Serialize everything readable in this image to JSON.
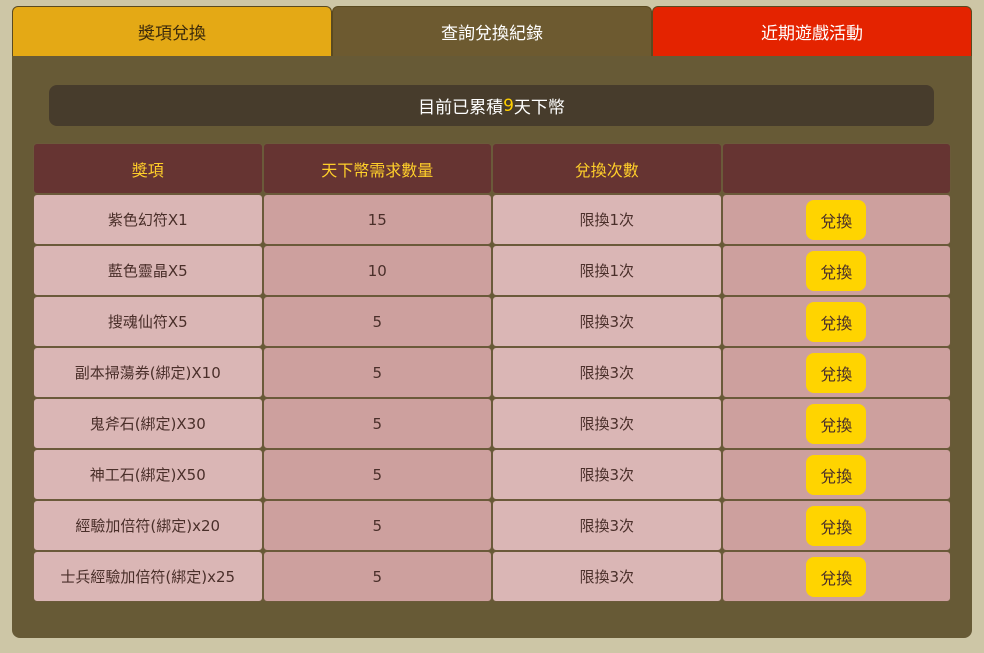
{
  "tabs": [
    {
      "label": "獎項兌換"
    },
    {
      "label": "查詢兌換紀錄"
    },
    {
      "label": "近期遊戲活動"
    }
  ],
  "banner": {
    "prefix": "目前已累積",
    "count": "9",
    "suffix": "天下幣"
  },
  "table": {
    "headers": [
      "獎項",
      "天下幣需求數量",
      "兌換次數",
      ""
    ],
    "button_label": "兌換",
    "rows": [
      {
        "item": "紫色幻符X1",
        "cost": "15",
        "limit": "限換1次"
      },
      {
        "item": "藍色靈晶X5",
        "cost": "10",
        "limit": "限換1次"
      },
      {
        "item": "搜魂仙符X5",
        "cost": "5",
        "limit": "限換3次"
      },
      {
        "item": "副本掃蕩券(綁定)X10",
        "cost": "5",
        "limit": "限換3次"
      },
      {
        "item": "鬼斧石(綁定)X30",
        "cost": "5",
        "limit": "限換3次"
      },
      {
        "item": "神工石(綁定)X50",
        "cost": "5",
        "limit": "限換3次"
      },
      {
        "item": "經驗加倍符(綁定)x20",
        "cost": "5",
        "limit": "限換3次"
      },
      {
        "item": "士兵經驗加倍符(綁定)x25",
        "cost": "5",
        "limit": "限換3次"
      }
    ]
  },
  "colors": {
    "tab_active": "#e4a915",
    "tab_records": "#6d5a30",
    "tab_events": "#e42300",
    "panel": "#675a36",
    "header_cell": "#663432",
    "header_text": "#ffcf2a",
    "button": "#ffd400"
  }
}
